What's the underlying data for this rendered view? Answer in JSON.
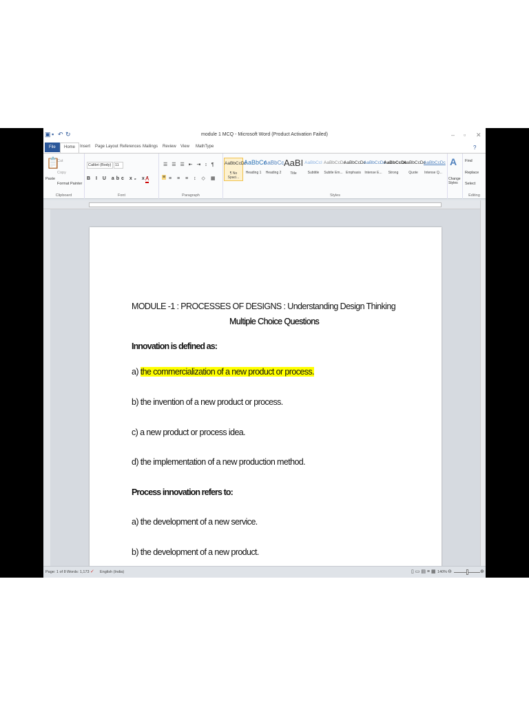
{
  "window": {
    "title": "module 1 MCQ - Microsoft Word (Product Activation Failed)"
  },
  "tabs": [
    "File",
    "Home",
    "Insert",
    "Page Layout",
    "References",
    "Mailings",
    "Review",
    "View",
    "MathType"
  ],
  "clipboard": {
    "paste": "Paste",
    "cut": "Cut",
    "copy": "Copy",
    "format_painter": "Format Painter",
    "label": "Clipboard"
  },
  "font": {
    "name": "Calibri (Body)",
    "size": "11",
    "label": "Font"
  },
  "paragraph": {
    "label": "Paragraph"
  },
  "styles": {
    "label": "Styles",
    "items": [
      {
        "preview": "AaBbCcDc",
        "name": "¶ No Spaci..."
      },
      {
        "preview": "AaBbCc",
        "name": "Heading 1"
      },
      {
        "preview": "AaBbCc",
        "name": "Heading 2"
      },
      {
        "preview": "AaBI",
        "name": "Title"
      },
      {
        "preview": "AaBbCcI",
        "name": "Subtitle"
      },
      {
        "preview": "AaBbCcDc",
        "name": "Subtle Em..."
      },
      {
        "preview": "AaBbCcDc",
        "name": "Emphasis"
      },
      {
        "preview": "AaBbCcDc",
        "name": "Intense E..."
      },
      {
        "preview": "AaBbCcDc",
        "name": "Strong"
      },
      {
        "preview": "AaBbCcDc",
        "name": "Quote"
      },
      {
        "preview": "AaBbCcDc",
        "name": "Intense Q..."
      }
    ],
    "change_styles": "Change Styles"
  },
  "editing": {
    "find": "Find",
    "replace": "Replace",
    "select": "Select",
    "label": "Editing"
  },
  "document": {
    "title_line": "MODULE -1 : PROCESSES OF DESIGNS : Understanding Design Thinking",
    "subtitle": "Multiple Choice Questions",
    "q1": "Innovation is defined as:",
    "q1_a_prefix": "a) ",
    "q1_a": "the commercialization of a new product or process.",
    "q1_b": "b) the invention of a new product or process.",
    "q1_c": "c) a new product or process idea.",
    "q1_d": "d) the implementation of a new production method.",
    "q2": "Process innovation refers to:",
    "q2_a": "a) the development of a new service.",
    "q2_b": "b) the development of a new product."
  },
  "status": {
    "page": "Page: 1 of 8",
    "words": "Words: 1,173",
    "language": "English (India)",
    "zoom": "140%"
  },
  "colors": {
    "file_tab": "#2b579a",
    "highlight": "#ffff00"
  }
}
